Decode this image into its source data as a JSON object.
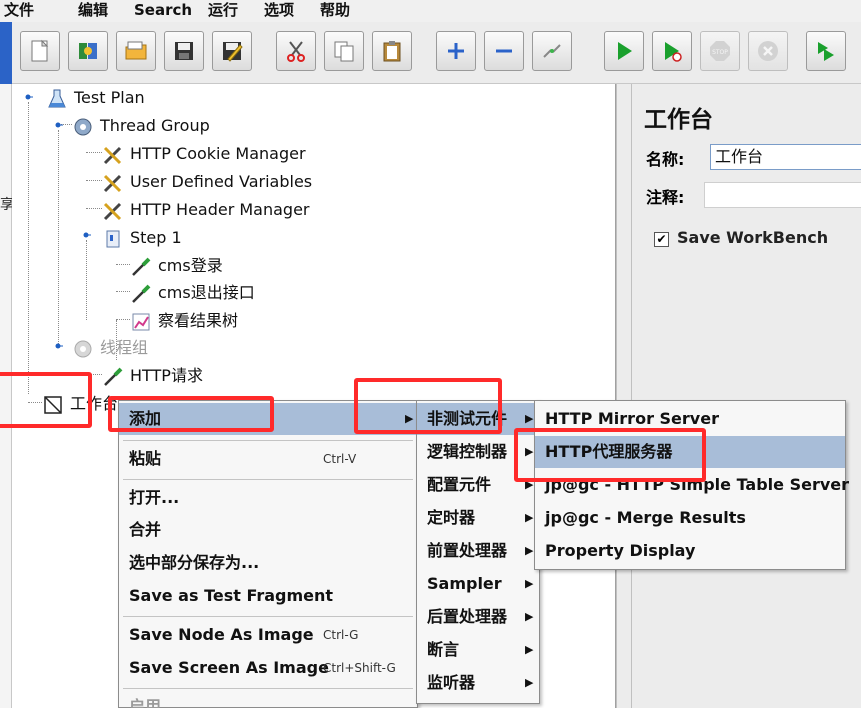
{
  "menubar": {
    "items": [
      "文件",
      "编辑",
      "Search",
      "运行",
      "选项",
      "帮助"
    ]
  },
  "toolbar": {
    "buttons": [
      "new-icon",
      "templates-icon",
      "open-icon",
      "save-icon",
      "save-as-icon",
      "cut-icon",
      "copy-icon",
      "paste-icon",
      "expand-icon",
      "collapse-icon",
      "toggle-icon",
      "start-icon",
      "start-no-pause-icon",
      "stop-icon",
      "shutdown-icon",
      "remote-start-icon"
    ]
  },
  "left_edge_char": "享",
  "tree": {
    "test_plan": "Test Plan",
    "thread_group": "Thread Group",
    "cookie_manager": "HTTP Cookie Manager",
    "user_vars": "User Defined Variables",
    "header_manager": "HTTP Header Manager",
    "step1": "Step 1",
    "cms_login": "cms登录",
    "cms_logout": "cms退出接口",
    "result_tree": "察看结果树",
    "thread_group_cn": "线程组",
    "http_request": "HTTP请求",
    "workbench": "工作台"
  },
  "right_panel": {
    "title": "工作台",
    "name_label": "名称:",
    "name_value": "工作台",
    "comment_label": "注释:",
    "save_workbench": "Save WorkBench"
  },
  "context_menu": {
    "add": "添加",
    "paste": "粘贴",
    "paste_shortcut": "Ctrl-V",
    "open": "打开...",
    "merge": "合并",
    "save_selection_as": "选中部分保存为...",
    "save_test_fragment": "Save as Test Fragment",
    "save_node_image": "Save Node As Image",
    "save_node_image_shortcut": "Ctrl-G",
    "save_screen_image": "Save Screen As Image",
    "save_screen_image_shortcut": "Ctrl+Shift-G",
    "enable": "启用"
  },
  "add_submenu": {
    "non_test_elements": "非测试元件",
    "logic_controller": "逻辑控制器",
    "config_element": "配置元件",
    "timer": "定时器",
    "pre_processor": "前置处理器",
    "sampler": "Sampler",
    "post_processor": "后置处理器",
    "assertion": "断言",
    "listener": "监听器"
  },
  "non_test_submenu": {
    "mirror_server": "HTTP Mirror Server",
    "proxy_server": "HTTP代理服务器",
    "simple_table_server": "jp@gc - HTTP Simple Table Server",
    "merge_results": "jp@gc - Merge Results",
    "property_display": "Property Display"
  },
  "colors": {
    "highlight": "#ff2a2a",
    "selection": "#a8bdd8",
    "accent": "#2b63c7"
  }
}
